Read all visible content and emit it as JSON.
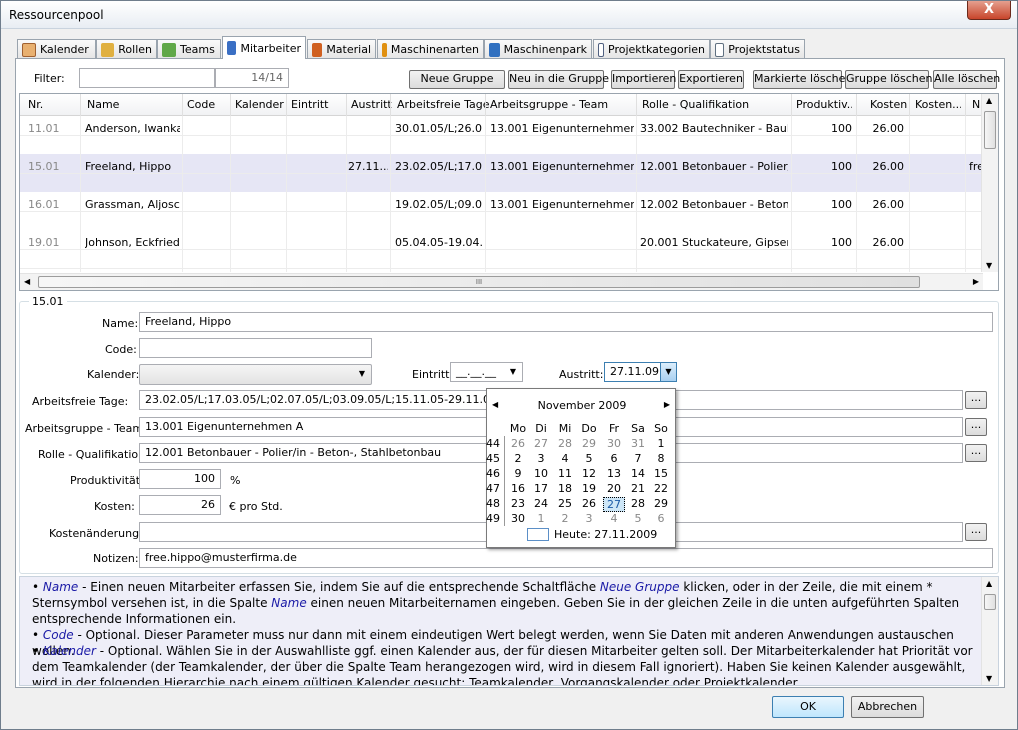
{
  "window": {
    "title": "Ressourcenpool",
    "close": "X"
  },
  "tabs": [
    {
      "label": "Kalender",
      "icon": "calendar-icon",
      "color": "#c96"
    },
    {
      "label": "Rollen",
      "icon": "roles-icon",
      "color": "#d9a030"
    },
    {
      "label": "Teams",
      "icon": "teams-icon",
      "color": "#58a040"
    },
    {
      "label": "Mitarbeiter",
      "icon": "employee-icon",
      "color": "#3a6fc4"
    },
    {
      "label": "Material",
      "icon": "material-icon",
      "color": "#d06020"
    },
    {
      "label": "Maschinenarten",
      "icon": "machine-types-icon",
      "color": "#d08010"
    },
    {
      "label": "Maschinenpark",
      "icon": "machine-park-icon",
      "color": "#3070c0"
    },
    {
      "label": "Projektkategorien",
      "icon": "project-categories-icon",
      "color": "#506080"
    },
    {
      "label": "Projektstatus",
      "icon": "project-status-icon",
      "color": "#607080"
    }
  ],
  "filter": {
    "label": "Filter:",
    "value": "",
    "count": "14/14"
  },
  "toolbar": {
    "neue_gruppe": "Neue Gruppe",
    "neu_in_gruppe": "Neu in die Gruppe",
    "importieren": "Importieren",
    "exportieren": "Exportieren",
    "markierte_loeschen": "Markierte löschen",
    "gruppe_loeschen": "Gruppe löschen",
    "alle_loeschen": "Alle löschen"
  },
  "grid": {
    "headers": [
      "Nr.",
      "Name",
      "Code",
      "Kalender",
      "Eintritt",
      "Austritt",
      "Arbeitsfreie Tage",
      "Arbeitsgruppe - Team",
      "Rolle - Qualifikation",
      "Produktiv...",
      "Kosten",
      "Kosten...",
      "N"
    ],
    "rows": [
      {
        "nr": "11.01",
        "name": "Anderson, Iwanka",
        "code": "",
        "kalender": "",
        "eintritt": "",
        "austritt": "",
        "frei": "30.01.05/L;26.0...",
        "team": "13.001 Eigenunternehmen A",
        "rolle": "33.002 Bautechniker - Baulei...",
        "prod": "100",
        "kosten": "26.00",
        "kaend": "",
        "notiz": ""
      },
      {
        "nr": "15.01",
        "name": "Freeland, Hippo",
        "code": "",
        "kalender": "",
        "eintritt": "",
        "austritt": "27.11....",
        "frei": "23.02.05/L;17.0...",
        "team": "13.001 Eigenunternehmen A",
        "rolle": "12.001 Betonbauer - Polier/i...",
        "prod": "100",
        "kosten": "26.00",
        "kaend": "",
        "notiz": "fre"
      },
      {
        "nr": "16.01",
        "name": "Grassman, Aljosc...",
        "code": "",
        "kalender": "",
        "eintritt": "",
        "austritt": "",
        "frei": "19.02.05/L;09.0...",
        "team": "13.001 Eigenunternehmen A",
        "rolle": "12.002 Betonbauer - Beton- ...",
        "prod": "100",
        "kosten": "26.00",
        "kaend": "",
        "notiz": ""
      },
      {
        "nr": "19.01",
        "name": "Johnson, Eckfried",
        "code": "",
        "kalender": "",
        "eintritt": "",
        "austritt": "",
        "frei": "05.04.05-19.04....",
        "team": "",
        "rolle": "20.001 Stuckateure, Gipser, ...",
        "prod": "100",
        "kosten": "26.00",
        "kaend": "",
        "notiz": ""
      }
    ],
    "hscroll_grip": "III"
  },
  "detail": {
    "group": "15.01",
    "name_label": "Name:",
    "name": "Freeland, Hippo",
    "code_label": "Code:",
    "code": "",
    "kalender_label": "Kalender:",
    "kalender": "",
    "eintritt_label": "Eintritt:",
    "eintritt": "__.__.__",
    "austritt_label": "Austritt:",
    "austritt": "27.11.09",
    "frei_label": "Arbeitsfreie Tage:",
    "frei": "23.02.05/L;17.03.05/L;02.07.05/L;03.09.05/L;15.11.05-29.11.05/U;12.02.",
    "team_label": "Arbeitsgruppe - Team:",
    "team": "13.001 Eigenunternehmen A",
    "rolle_label": "Rolle - Qualifikation:",
    "rolle": "12.001 Betonbauer - Polier/in - Beton-, Stahlbetonbau",
    "prod_label": "Produktivität:",
    "prod": "100",
    "prod_unit": "%",
    "kosten_label": "Kosten:",
    "kosten": "26",
    "kosten_unit": "€ pro Std.",
    "kaend_label": "Kostenänderung:",
    "kaend": "",
    "notiz_label": "Notizen:",
    "notiz": "free.hippo@musterfirma.de",
    "dots": "..."
  },
  "calendar": {
    "month": "November 2009",
    "weekdays": [
      "Mo",
      "Di",
      "Mi",
      "Do",
      "Fr",
      "Sa",
      "So"
    ],
    "weeks": [
      {
        "wk": "44",
        "days": [
          "26",
          "27",
          "28",
          "29",
          "30",
          "31",
          "1"
        ],
        "other": [
          1,
          1,
          1,
          1,
          1,
          1,
          0
        ]
      },
      {
        "wk": "45",
        "days": [
          "2",
          "3",
          "4",
          "5",
          "6",
          "7",
          "8"
        ],
        "other": [
          0,
          0,
          0,
          0,
          0,
          0,
          0
        ]
      },
      {
        "wk": "46",
        "days": [
          "9",
          "10",
          "11",
          "12",
          "13",
          "14",
          "15"
        ],
        "other": [
          0,
          0,
          0,
          0,
          0,
          0,
          0
        ]
      },
      {
        "wk": "47",
        "days": [
          "16",
          "17",
          "18",
          "19",
          "20",
          "21",
          "22"
        ],
        "other": [
          0,
          0,
          0,
          0,
          0,
          0,
          0
        ]
      },
      {
        "wk": "48",
        "days": [
          "23",
          "24",
          "25",
          "26",
          "27",
          "28",
          "29"
        ],
        "other": [
          0,
          0,
          0,
          0,
          0,
          0,
          0
        ]
      },
      {
        "wk": "49",
        "days": [
          "30",
          "1",
          "2",
          "3",
          "4",
          "5",
          "6"
        ],
        "other": [
          0,
          1,
          1,
          1,
          1,
          1,
          1
        ]
      }
    ],
    "selected": "27",
    "today": "Heute: 27.11.2009"
  },
  "help": [
    {
      "key": "Name",
      "text": " - Einen neuen Mitarbeiter erfassen Sie, indem Sie auf die entsprechende Schaltfläche ",
      "key2": "Neue Gruppe",
      "text2": " klicken, oder in der Zeile, die mit einem * Sternsymbol versehen ist, in die Spalte ",
      "key3": "Name",
      "text3": " einen neuen Mitarbeiternamen eingeben. Geben Sie in der gleichen Zeile in die unten aufgeführten Spalten entsprechende Informationen ein."
    },
    {
      "key": "Code",
      "text": " - Optional. Dieser Parameter muss nur dann mit einem eindeutigen Wert belegt werden, wenn Sie Daten mit anderen Anwendungen austauschen wollen."
    },
    {
      "key": "Kalender",
      "text": " - Optional. Wählen Sie in der Auswahlliste ggf. einen Kalender aus, der für diesen Mitarbeiter gelten soll. Der Mitarbeiterkalender hat Priorität vor dem Teamkalender (der Teamkalender, der über die Spalte Team herangezogen wird, wird in diesem Fall ignoriert). Haben Sie keinen Kalender ausgewählt, wird in der folgenden Hierarchie nach einem gültigen Kalender gesucht: Teamkalender, Vorgangskalender oder Projektkalender."
    }
  ],
  "footer": {
    "ok": "OK",
    "cancel": "Abbrechen"
  }
}
